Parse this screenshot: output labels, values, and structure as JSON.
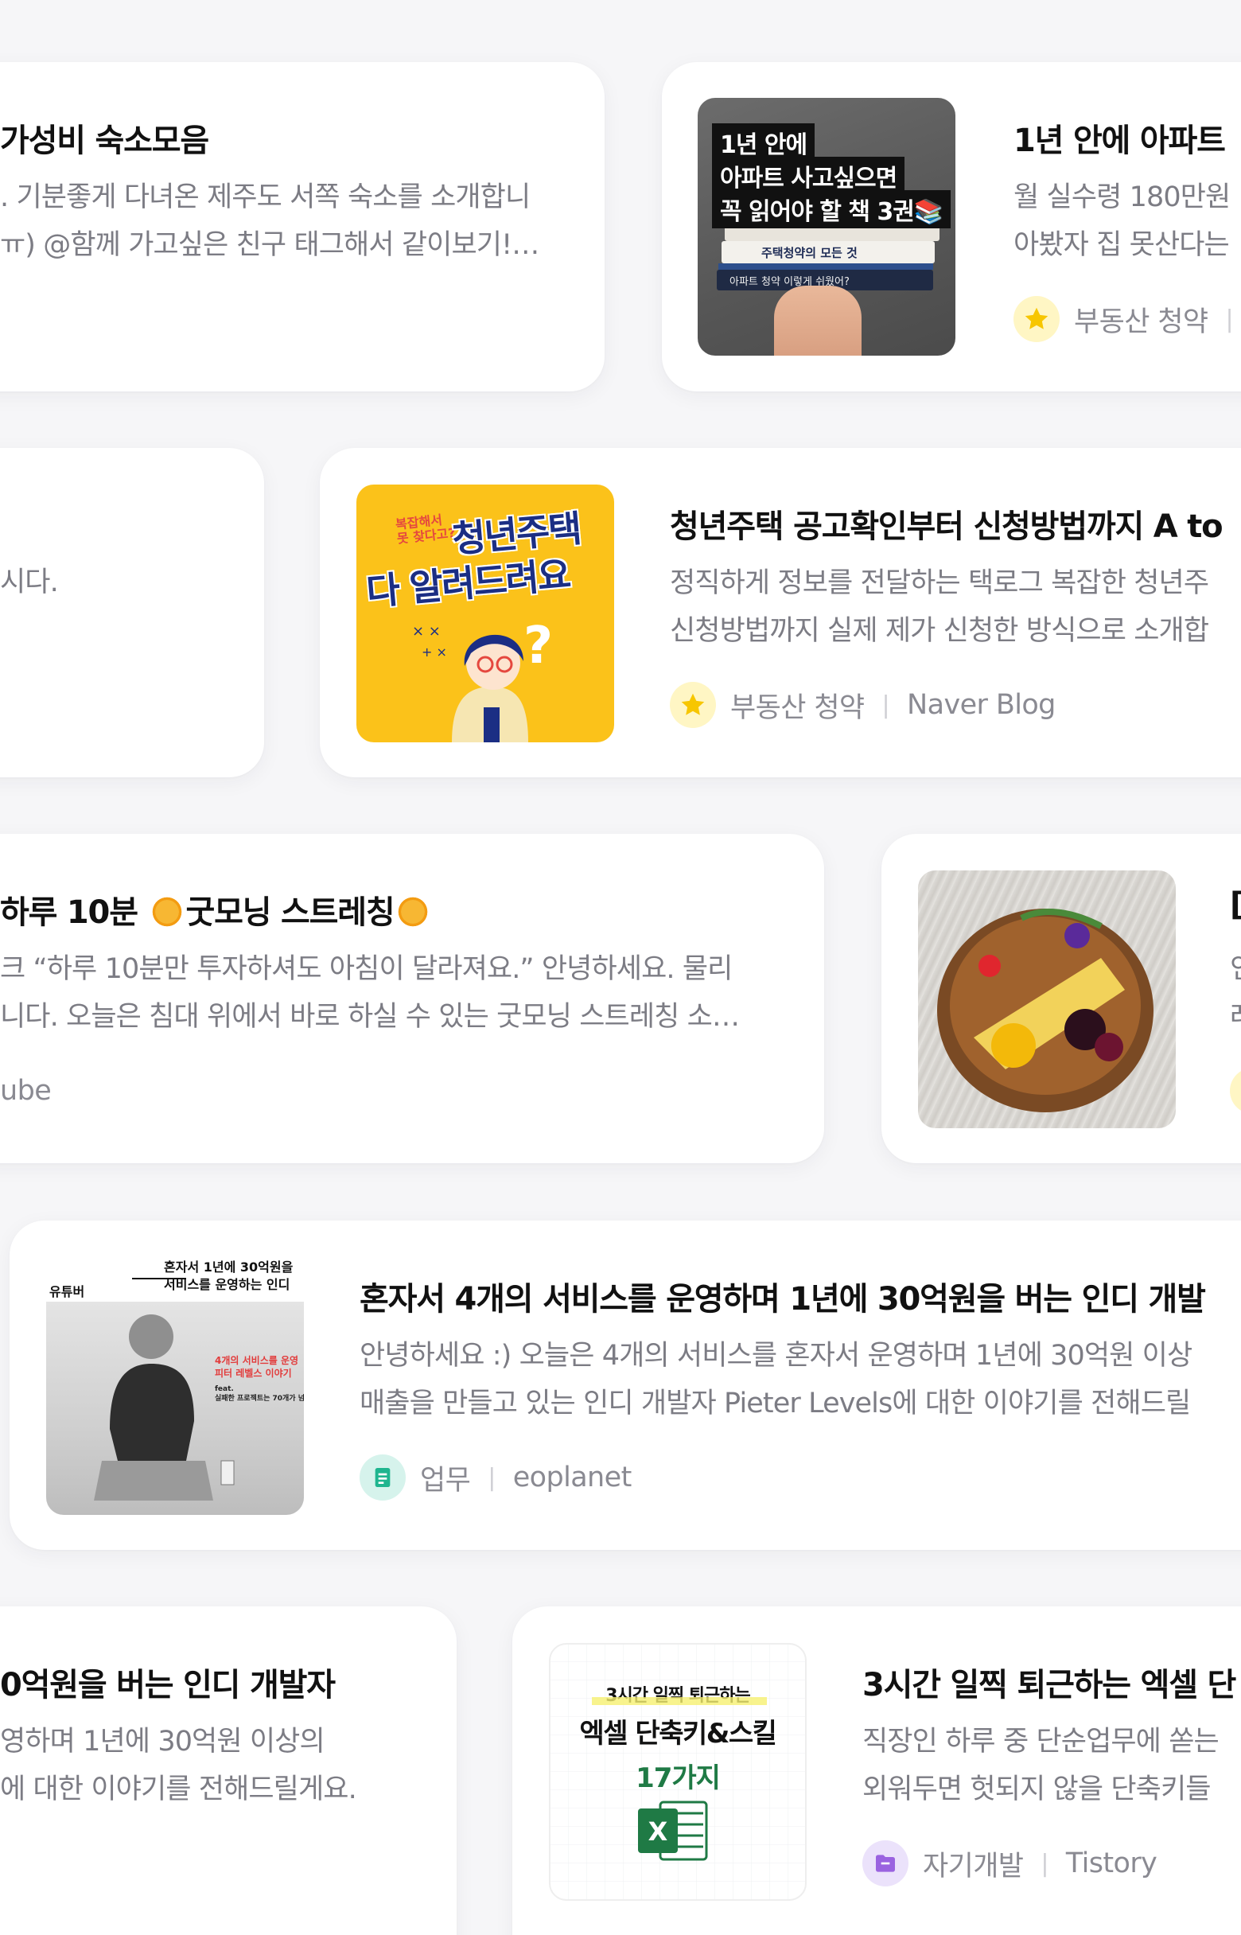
{
  "cards": [
    {
      "title": "가성비 숙소모음",
      "desc1": ". 기분좋게 다녀온 제주도 서쪽 숙소를 소개합니",
      "desc2": "ㅠ) @함께 가고싶은 친구 태그해서 같이보기!…"
    },
    {
      "title": "1년 안에 아파트 ",
      "desc1": "월 실수령 180만원",
      "desc2": "아봤자 집 못산다는",
      "category": "부동산 청약",
      "source": "I",
      "badge_icon": "star-icon",
      "thumb_lines": [
        "1년 안에",
        "아파트 사고싶으면",
        "꼭 읽어야 할 책 3권📚"
      ],
      "book_spine_1": "주택청약의 모든 것",
      "book_spine_2": "아파트 청약 이렇게 쉬웠어?"
    },
    {
      "desc": "시다."
    },
    {
      "title": "청년주택 공고확인부터 신청방법까지 A to",
      "desc1": "정직하게 정보를 전달하는 택로그 복잡한 청년주",
      "desc2": "신청방법까지 실제 제가 신청한 방식으로 소개합",
      "category": "부동산 청약",
      "source": "Naver Blog",
      "badge_icon": "star-icon",
      "thumb_small": "복잡해서\n못 찾다고?",
      "thumb_big1": "청년주택",
      "thumb_big2": "다 알려드려요"
    },
    {
      "title_a": "하루 10분 ",
      "title_b": "굿모닝 스트레칭",
      "desc1": "크 “하루 10분만 투자하셔도 아침이 달라져요.” 안녕하세요. 물리",
      "desc2": "니다. 오늘은 침대 위에서 바로 하실 수 있는 굿모닝 스트레칭 소…",
      "source": "ube"
    },
    {
      "title": "[",
      "desc1": "인",
      "desc2": "레"
    },
    {
      "title": "혼자서 4개의 서비스를 운영하며 1년에 30억원을 버는 인디 개발",
      "desc1": "안녕하세요 :) 오늘은 4개의 서비스를 혼자서 운영하며 1년에 30억원 이상",
      "desc2": "매출을 만들고 있는 인디 개발자 Pieter Levels에 대한 이야기를 전해드릴",
      "category": "업무",
      "source": "eoplanet",
      "badge_icon": "note-icon",
      "thumb_top_left": "유튜버",
      "thumb_top_right": "혼자서 1년에 30억원을\n서비스를 운영하는 인디",
      "thumb_red": "4개의 서비스를 운영\n피터 레벨스 이야기",
      "thumb_feat": "feat.\n실패한 프로젝트는 70개가 넘"
    },
    {
      "title": "0억원을 버는 인디 개발자",
      "desc1": "영하며 1년에 30억원 이상의",
      "desc2": "에 대한 이야기를 전해드릴게요."
    },
    {
      "title": "3시간 일찍 퇴근하는 엑셀 단",
      "desc1": "직장인 하루 중 단순업무에 쏟는",
      "desc2": "외워두면 헛되지 않을 단축키들",
      "category": "자기개발",
      "source": "Tistory",
      "badge_icon": "folder-icon",
      "thumb_line1": "3시간 일찍 퇴근하는",
      "thumb_line2": "엑셀 단축키&스킬",
      "thumb_line3": "17가지"
    }
  ],
  "colors": {
    "star_badge_bg": "#fff6c4",
    "star": "#f7c600",
    "note_badge_bg": "#d6f3ec",
    "note": "#1fb58f",
    "folder_badge_bg": "#ebe2fb",
    "folder": "#9a63e0",
    "housing_thumb_bg": "#fbc21a",
    "excel_green": "#1f7a45"
  }
}
